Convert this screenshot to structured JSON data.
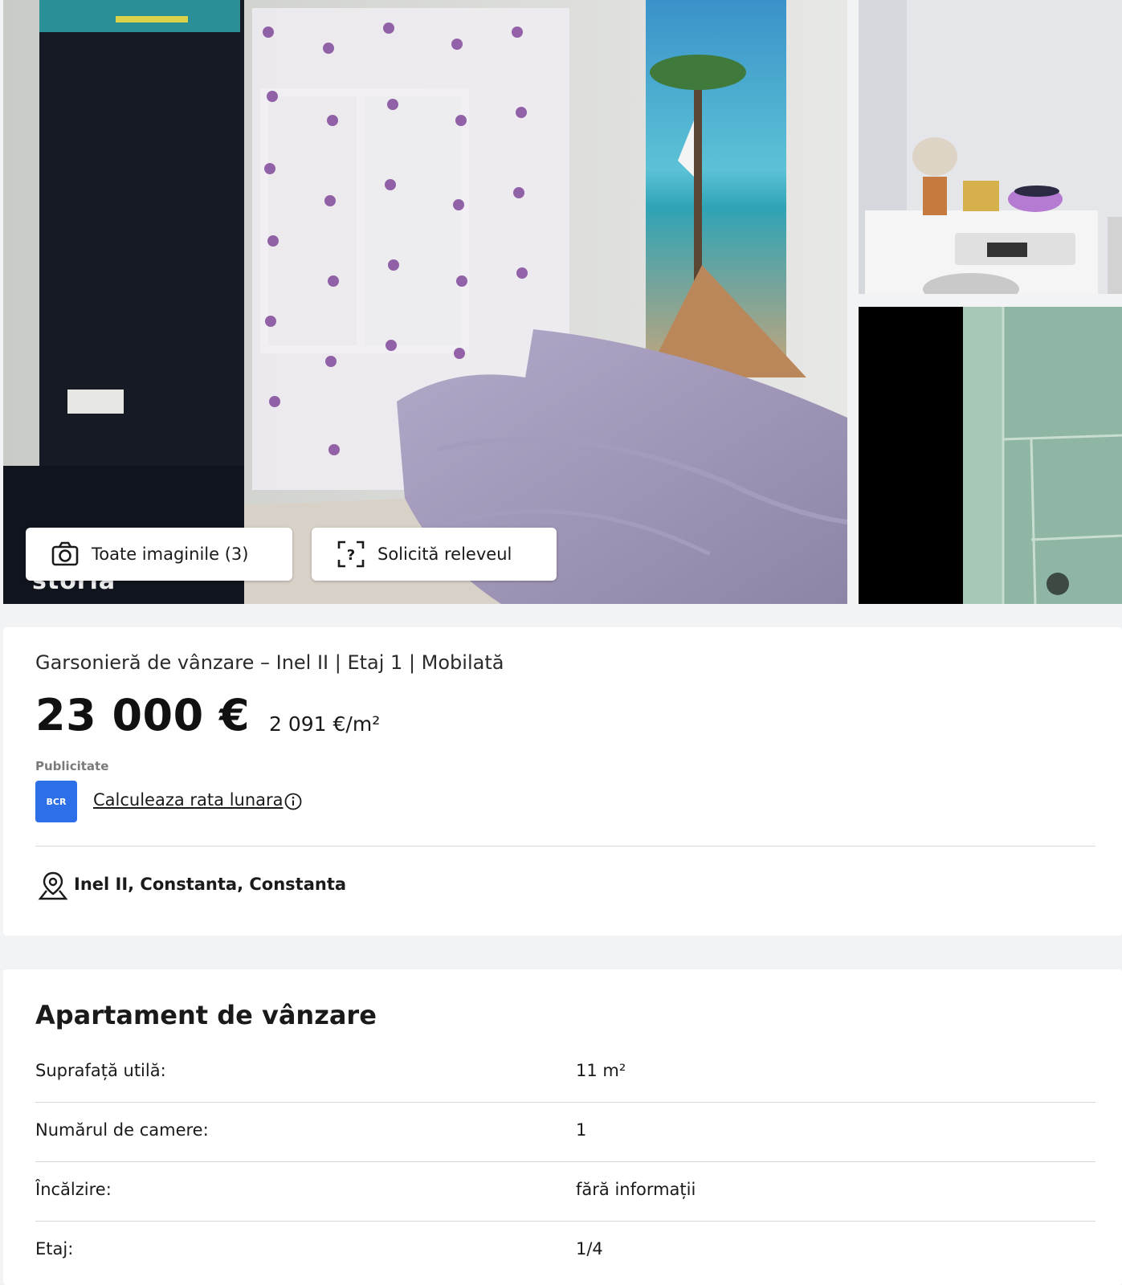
{
  "gallery": {
    "watermark": "storia",
    "all_images_button": "Toate imaginile (3)",
    "floorplan_button": "Solicită releveul",
    "icons": [
      "camera-icon",
      "floorplan-question-icon"
    ]
  },
  "listing": {
    "subtitle": "Garsonieră de vânzare – Inel II | Etaj 1 | Mobilată",
    "price": "23 000 €",
    "price_per_sqm": "2 091 €/m²",
    "ad_label": "Publicitate",
    "bank_logo_text": "BCR",
    "calculator_link": "Calculeaza rata lunara",
    "address": "Inel II, Constanta, Constanta"
  },
  "details": {
    "title": "Apartament de vânzare",
    "rows": [
      {
        "label": "Suprafață utilă:",
        "value": "11 m²"
      },
      {
        "label": "Numărul de camere:",
        "value": "1"
      },
      {
        "label": "Încălzire:",
        "value": "fără informații"
      },
      {
        "label": "Etaj:",
        "value": "1/4"
      }
    ]
  },
  "colors": {
    "page_bg": "#f2f3f5",
    "card_bg": "#ffffff",
    "bank_blue": "#2d6fe6",
    "divider": "#d8d8d8"
  }
}
